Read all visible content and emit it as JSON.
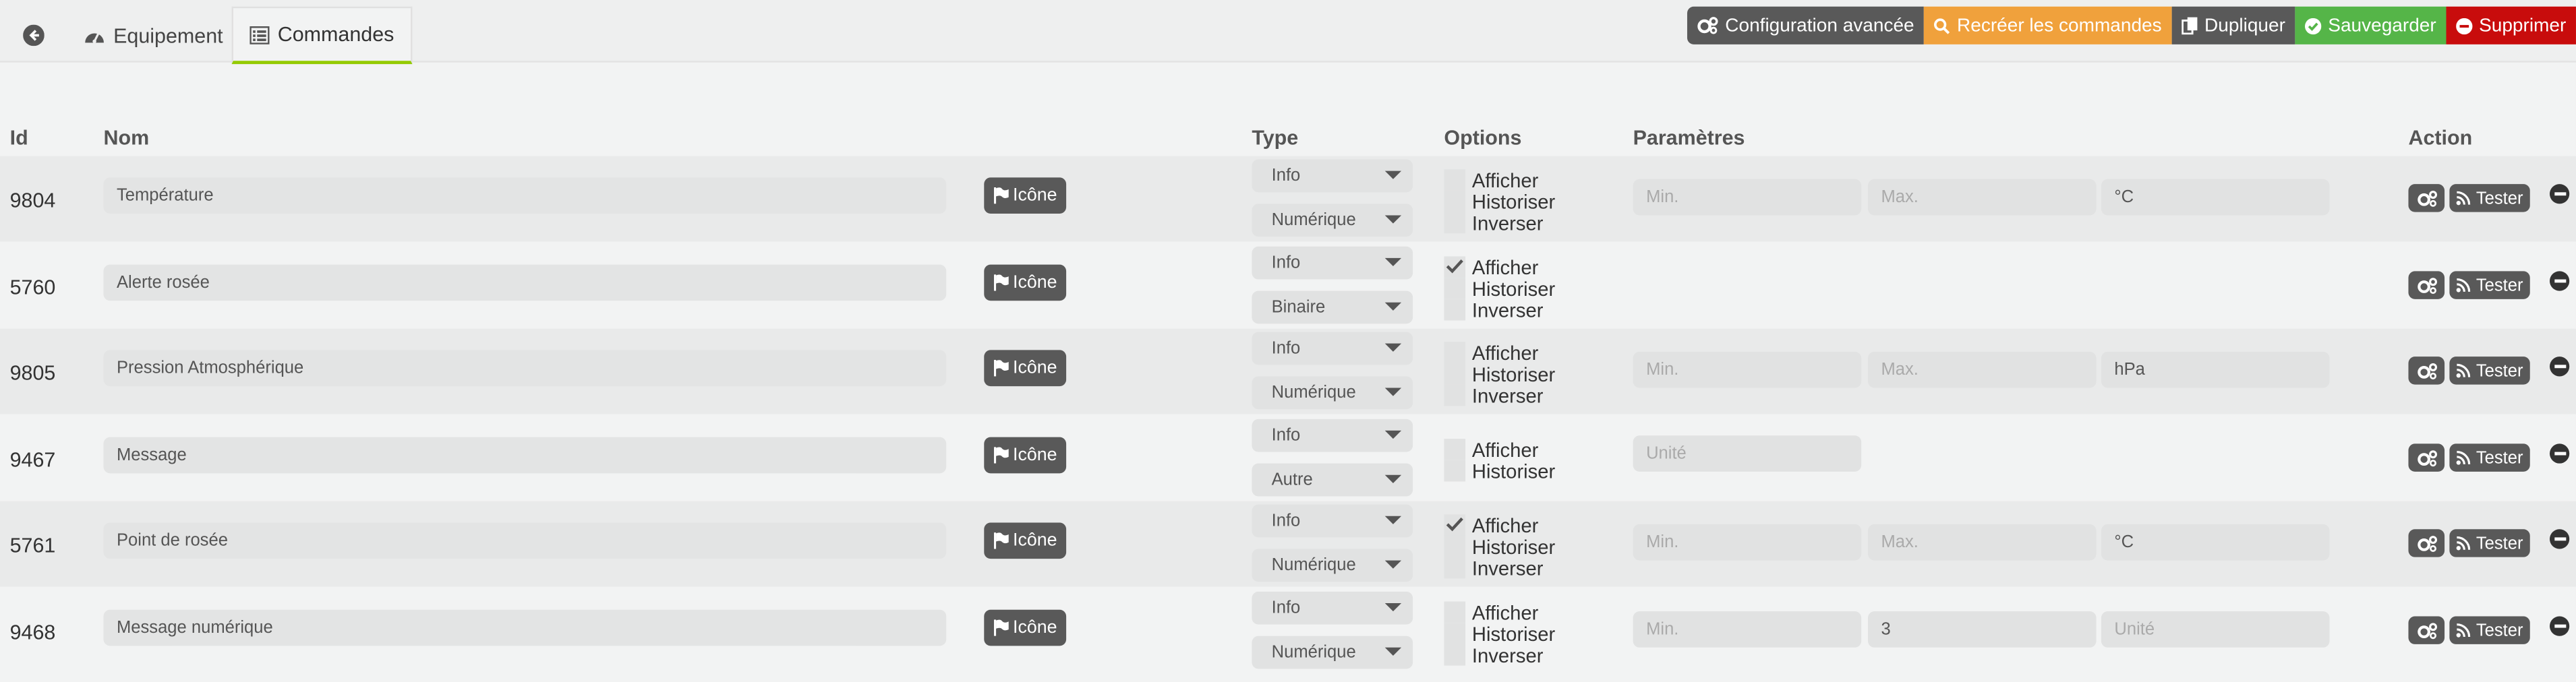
{
  "tabs": {
    "equipment": "Equipement",
    "commands": "Commandes"
  },
  "toolbar": {
    "advanced_config": "Configuration avancée",
    "recreate": "Recréer les commandes",
    "duplicate": "Dupliquer",
    "save": "Sauvegarder",
    "delete": "Supprimer"
  },
  "headers": {
    "id": "Id",
    "name": "Nom",
    "type": "Type",
    "options": "Options",
    "params": "Paramètres",
    "action": "Action"
  },
  "labels": {
    "icon_button": "Icône",
    "test_button": "Tester",
    "opt_show": "Afficher",
    "opt_history": "Historiser",
    "opt_invert": "Inverser"
  },
  "colors": {
    "recreate": "#f0a13c",
    "save": "#55b548",
    "delete": "#c80c0c",
    "dark_button": "#595959",
    "active_tab_underline": "#94ca02"
  },
  "rows": [
    {
      "id": "9804",
      "name": "Température",
      "type": "Info",
      "subtype": "Numérique",
      "show": false,
      "params": [
        {
          "text": "Min.",
          "placeholder": true
        },
        {
          "text": "Max.",
          "placeholder": true
        },
        {
          "text": "°C",
          "placeholder": false
        }
      ]
    },
    {
      "id": "5760",
      "name": "Alerte rosée",
      "type": "Info",
      "subtype": "Binaire",
      "show": true,
      "params": []
    },
    {
      "id": "9805",
      "name": "Pression Atmosphérique",
      "type": "Info",
      "subtype": "Numérique",
      "show": false,
      "params": [
        {
          "text": "Min.",
          "placeholder": true
        },
        {
          "text": "Max.",
          "placeholder": true
        },
        {
          "text": "hPa",
          "placeholder": false
        }
      ]
    },
    {
      "id": "9467",
      "name": "Message",
      "type": "Info",
      "subtype": "Autre",
      "show": false,
      "params": [
        {
          "text": "Unité",
          "placeholder": true
        }
      ]
    },
    {
      "id": "5761",
      "name": "Point de rosée",
      "type": "Info",
      "subtype": "Numérique",
      "show": true,
      "params": [
        {
          "text": "Min.",
          "placeholder": true
        },
        {
          "text": "Max.",
          "placeholder": true
        },
        {
          "text": "°C",
          "placeholder": false
        }
      ]
    },
    {
      "id": "9468",
      "name": "Message numérique",
      "type": "Info",
      "subtype": "Numérique",
      "show": false,
      "params": [
        {
          "text": "Min.",
          "placeholder": true
        },
        {
          "text": "3",
          "placeholder": false
        },
        {
          "text": "Unité",
          "placeholder": true
        }
      ]
    }
  ]
}
